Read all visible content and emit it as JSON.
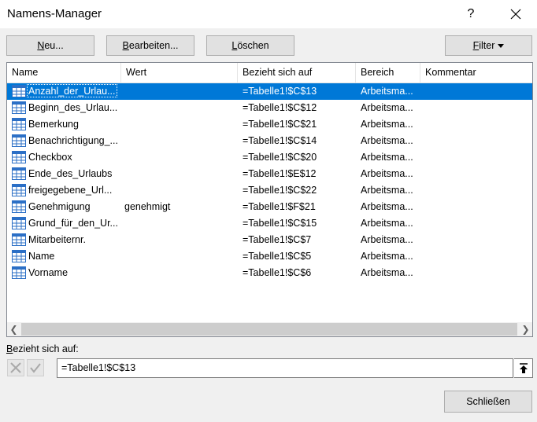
{
  "window": {
    "title": "Namens-Manager",
    "help_label": "?",
    "close_label": "✕"
  },
  "toolbar": {
    "new": {
      "pre": "",
      "acc": "N",
      "post": "eu..."
    },
    "edit": {
      "pre": "",
      "acc": "B",
      "post": "earbeiten..."
    },
    "delete": {
      "pre": "",
      "acc": "L",
      "post": "öschen"
    },
    "filter": {
      "pre": "",
      "acc": "F",
      "post": "ilter"
    }
  },
  "table": {
    "columns": [
      "Name",
      "Wert",
      "Bezieht sich auf",
      "Bereich",
      "Kommentar"
    ],
    "rows": [
      {
        "name": "Anzahl_der_Urlau...",
        "value": "",
        "refers_to": "=Tabelle1!$C$13",
        "scope": "Arbeitsma...",
        "comment": ""
      },
      {
        "name": "Beginn_des_Urlau...",
        "value": "",
        "refers_to": "=Tabelle1!$C$12",
        "scope": "Arbeitsma...",
        "comment": ""
      },
      {
        "name": "Bemerkung",
        "value": "",
        "refers_to": "=Tabelle1!$C$21",
        "scope": "Arbeitsma...",
        "comment": ""
      },
      {
        "name": "Benachrichtigung_...",
        "value": "",
        "refers_to": "=Tabelle1!$C$14",
        "scope": "Arbeitsma...",
        "comment": ""
      },
      {
        "name": "Checkbox",
        "value": "",
        "refers_to": "=Tabelle1!$C$20",
        "scope": "Arbeitsma...",
        "comment": ""
      },
      {
        "name": "Ende_des_Urlaubs",
        "value": "",
        "refers_to": "=Tabelle1!$E$12",
        "scope": "Arbeitsma...",
        "comment": ""
      },
      {
        "name": "freigegebene_Url...",
        "value": "",
        "refers_to": "=Tabelle1!$C$22",
        "scope": "Arbeitsma...",
        "comment": ""
      },
      {
        "name": "Genehmigung",
        "value": "genehmigt",
        "refers_to": "=Tabelle1!$F$21",
        "scope": "Arbeitsma...",
        "comment": ""
      },
      {
        "name": "Grund_für_den_Ur...",
        "value": "",
        "refers_to": "=Tabelle1!$C$15",
        "scope": "Arbeitsma...",
        "comment": ""
      },
      {
        "name": "Mitarbeiternr.",
        "value": "",
        "refers_to": "=Tabelle1!$C$7",
        "scope": "Arbeitsma...",
        "comment": ""
      },
      {
        "name": "Name",
        "value": "",
        "refers_to": "=Tabelle1!$C$5",
        "scope": "Arbeitsma...",
        "comment": ""
      },
      {
        "name": "Vorname",
        "value": "",
        "refers_to": "=Tabelle1!$C$6",
        "scope": "Arbeitsma...",
        "comment": ""
      }
    ],
    "selected_index": 0,
    "row_icon": "named-range-grid-icon"
  },
  "refers_to": {
    "label": "Bezieht sich auf:",
    "value": "=Tabelle1!$C$13"
  },
  "footer": {
    "close_button": "Schließen"
  },
  "colors": {
    "selection": "#0078d7",
    "icon_blue": "#2b6fc6"
  }
}
